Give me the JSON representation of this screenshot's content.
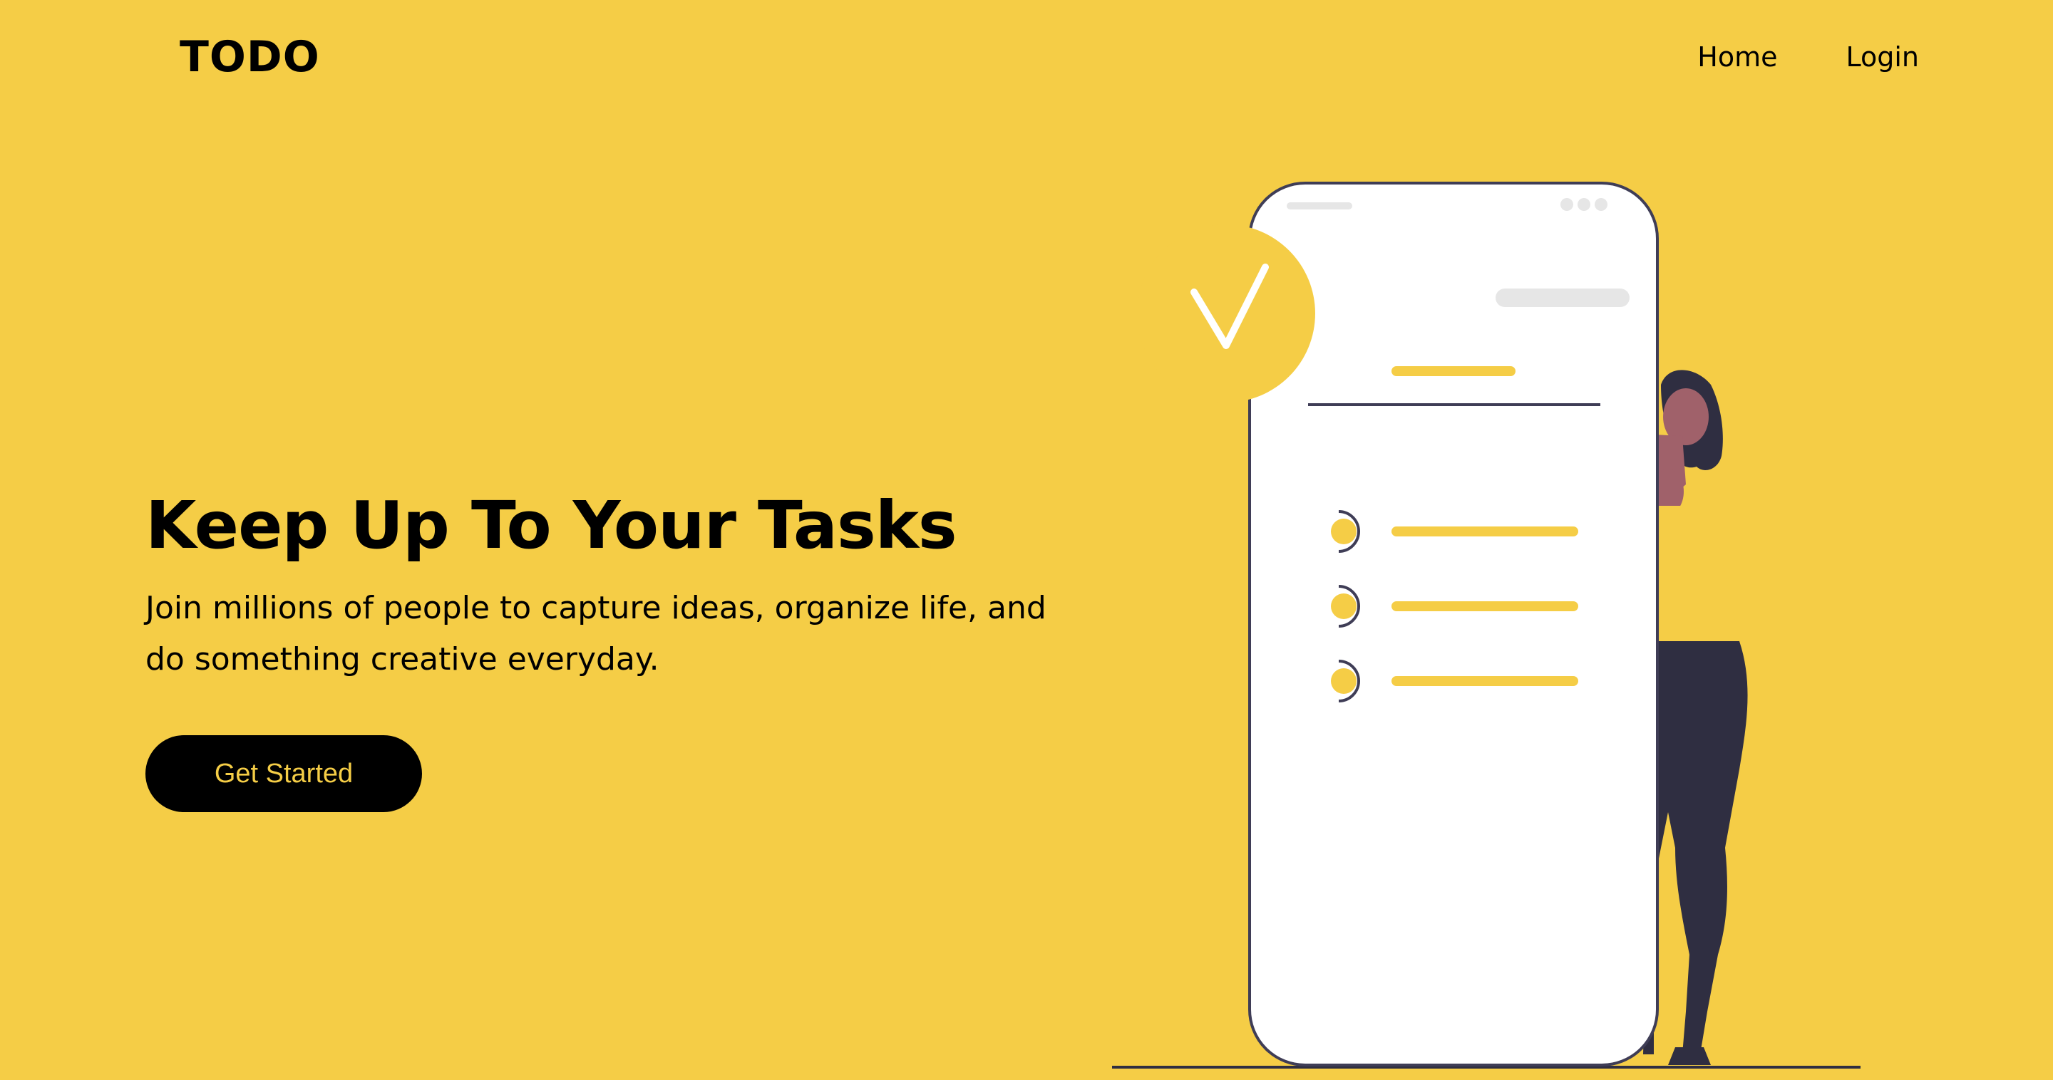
{
  "brand": {
    "name": "TODO"
  },
  "nav": {
    "items": [
      {
        "label": "Home"
      },
      {
        "label": "Login"
      }
    ]
  },
  "hero": {
    "title": "Keep Up To Your Tasks",
    "subtitle": "Join millions of people to capture ideas, organize life, and do something creative everyday.",
    "cta_label": "Get Started"
  },
  "theme": {
    "background": "#f5cd46",
    "text": "#000000",
    "accent": "#f5cd46",
    "ink": "#2f2e41"
  },
  "illustration": {
    "icon": "checkmark-icon",
    "task_item_count": 3
  }
}
